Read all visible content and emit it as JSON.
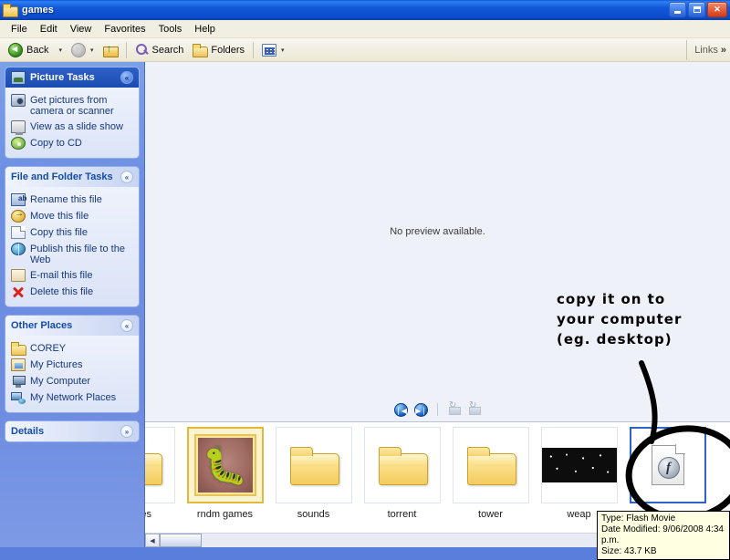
{
  "window": {
    "title": "games",
    "title_icon": "folder-icon",
    "buttons": {
      "minimize": "minimize-icon",
      "restore": "restore-icon",
      "close": "close-icon"
    }
  },
  "menu": {
    "items": [
      "File",
      "Edit",
      "View",
      "Favorites",
      "Tools",
      "Help"
    ]
  },
  "toolbar": {
    "back_label": "Back",
    "back_icon": "back-arrow-icon",
    "forward_icon": "forward-arrow-icon",
    "up_icon": "up-folder-icon",
    "search_label": "Search",
    "search_icon": "search-icon",
    "folders_label": "Folders",
    "folders_icon": "folders-icon",
    "views_icon": "views-icon",
    "links_label": "Links",
    "links_chevron": "»",
    "caret": "▾"
  },
  "sidebar": {
    "panels": [
      {
        "title": "Picture Tasks",
        "style": "blue",
        "chevron": "«",
        "items": [
          {
            "label": "Get pictures from camera or scanner",
            "icon": "camera-icon"
          },
          {
            "label": "View as a slide show",
            "icon": "slideshow-icon"
          },
          {
            "label": "Copy to CD",
            "icon": "cd-icon"
          }
        ]
      },
      {
        "title": "File and Folder Tasks",
        "style": "light",
        "chevron": "«",
        "items": [
          {
            "label": "Rename this file",
            "icon": "rename-icon"
          },
          {
            "label": "Move this file",
            "icon": "move-icon"
          },
          {
            "label": "Copy this file",
            "icon": "copy-icon"
          },
          {
            "label": "Publish this file to the Web",
            "icon": "globe-icon"
          },
          {
            "label": "E-mail this file",
            "icon": "email-icon"
          },
          {
            "label": "Delete this file",
            "icon": "delete-x-icon"
          }
        ]
      },
      {
        "title": "Other Places",
        "style": "light",
        "chevron": "«",
        "items": [
          {
            "label": "COREY",
            "icon": "folder-icon"
          },
          {
            "label": "My Pictures",
            "icon": "my-pictures-icon"
          },
          {
            "label": "My Computer",
            "icon": "my-computer-icon"
          },
          {
            "label": "My Network Places",
            "icon": "network-places-icon"
          }
        ]
      },
      {
        "title": "Details",
        "style": "light",
        "chevron": "»",
        "items": []
      }
    ]
  },
  "main": {
    "preview_text": "No preview available.",
    "controls": {
      "previous_icon": "previous-image-icon",
      "next_icon": "next-image-icon",
      "previous_glyph": "❘◀",
      "next_glyph": "▶❘",
      "rotate_ccw_icon": "rotate-counterclockwise-icon",
      "rotate_cw_icon": "rotate-clockwise-icon"
    },
    "filmstrip": [
      {
        "label": "games",
        "type": "folder",
        "selected": false,
        "clipped": true
      },
      {
        "label": "rndm games",
        "type": "photo-folder",
        "selected": true,
        "thumb": "butterfly-thumbnail"
      },
      {
        "label": "sounds",
        "type": "folder",
        "selected": false
      },
      {
        "label": "torrent",
        "type": "folder",
        "selected": false
      },
      {
        "label": "tower",
        "type": "folder",
        "selected": false
      },
      {
        "label": "weap",
        "type": "dark-thumbnail",
        "selected": false
      },
      {
        "label": "",
        "type": "flash-file",
        "selected": true,
        "icon": "flash-movie-icon"
      }
    ],
    "scrollbar": {
      "left_arrow": "◀",
      "right_arrow": "▶"
    }
  },
  "tooltip": {
    "type_line": "Type: Flash Movie",
    "date_line": "Date Modified: 9/06/2008 4:34 p.m.",
    "size_line": "Size: 43.7 KB"
  },
  "annotation": {
    "line1": "copy it on to",
    "line2": "your computer",
    "line3": "(eg. desktop)",
    "color": "#000000",
    "shape": "hand-drawn-circle-with-arrow"
  }
}
